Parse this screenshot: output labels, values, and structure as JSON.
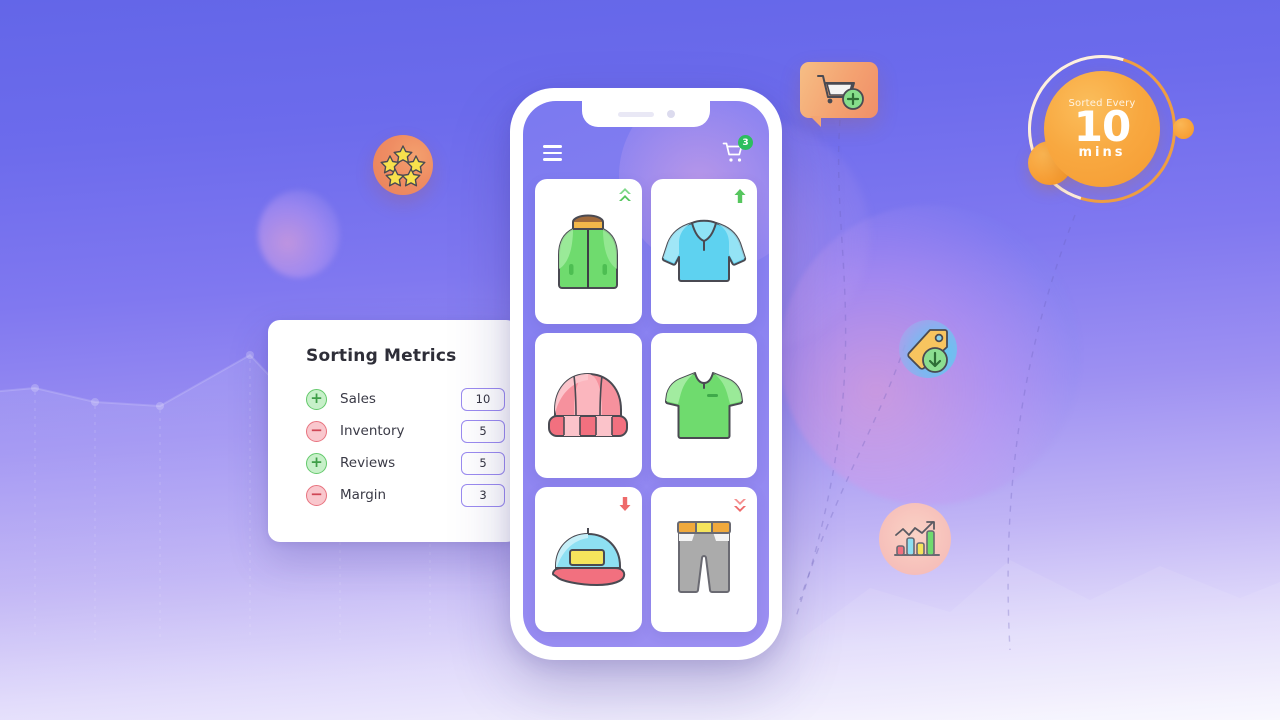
{
  "background": {
    "gradient_top": "#6366E8",
    "gradient_bottom": "#F9F8FE",
    "accent_purple": "#9B8BF0",
    "accent_orange": "#F59B32",
    "accent_green": "#2DBE5F",
    "decor": [
      {
        "name": "blob-large",
        "type": "circle"
      },
      {
        "name": "blob-small",
        "type": "circle"
      },
      {
        "name": "line-chart-silhouette",
        "type": "area-chart"
      },
      {
        "name": "dashed-connector-lines",
        "type": "dashed-path"
      }
    ]
  },
  "metrics_card": {
    "title": "Sorting Metrics",
    "rows": [
      {
        "direction": "up",
        "sign": "+",
        "label": "Sales",
        "value": "10"
      },
      {
        "direction": "down",
        "sign": "−",
        "label": "Inventory",
        "value": "5"
      },
      {
        "direction": "up",
        "sign": "+",
        "label": "Reviews",
        "value": "5"
      },
      {
        "direction": "down",
        "sign": "−",
        "label": "Margin",
        "value": "3"
      }
    ]
  },
  "phone": {
    "topbar": {
      "menu_icon": "hamburger-menu-icon",
      "cart_icon": "shopping-cart-icon",
      "cart_count": "3"
    },
    "products": [
      {
        "name": "vest",
        "icon": "green-vest-icon",
        "trend": "double-up",
        "trend_color": "#56C65E"
      },
      {
        "name": "hoodie",
        "icon": "blue-hoodie-icon",
        "trend": "single-up",
        "trend_color": "#56C65E"
      },
      {
        "name": "beanie",
        "icon": "pink-beanie-icon",
        "trend": "none",
        "trend_color": ""
      },
      {
        "name": "tshirt",
        "icon": "green-tshirt-icon",
        "trend": "none",
        "trend_color": ""
      },
      {
        "name": "cap",
        "icon": "baseball-cap-icon",
        "trend": "single-down",
        "trend_color": "#EE6A6A"
      },
      {
        "name": "pants",
        "icon": "grey-pants-icon",
        "trend": "double-down",
        "trend_color": "#EE6A6A"
      }
    ]
  },
  "badges": {
    "stars": {
      "name": "five-stars-badge",
      "star_count": 5,
      "color": "#EF8D63"
    },
    "cart_bubble": {
      "name": "add-to-cart-bubble",
      "icon": "cart-plus-icon",
      "color": "#F4A271"
    },
    "price_tag": {
      "name": "price-drop-badge",
      "icon": "price-tag-down-icon",
      "color": "#7FB6F0"
    },
    "growth_chart": {
      "name": "growth-chart-badge",
      "icon": "bar-chart-trend-icon",
      "color": "#F7C3BC"
    },
    "timer": {
      "name": "sorted-every-timer-badge",
      "label": "Sorted Every",
      "number": "10",
      "unit": "mins",
      "color": "#F59B32"
    }
  }
}
